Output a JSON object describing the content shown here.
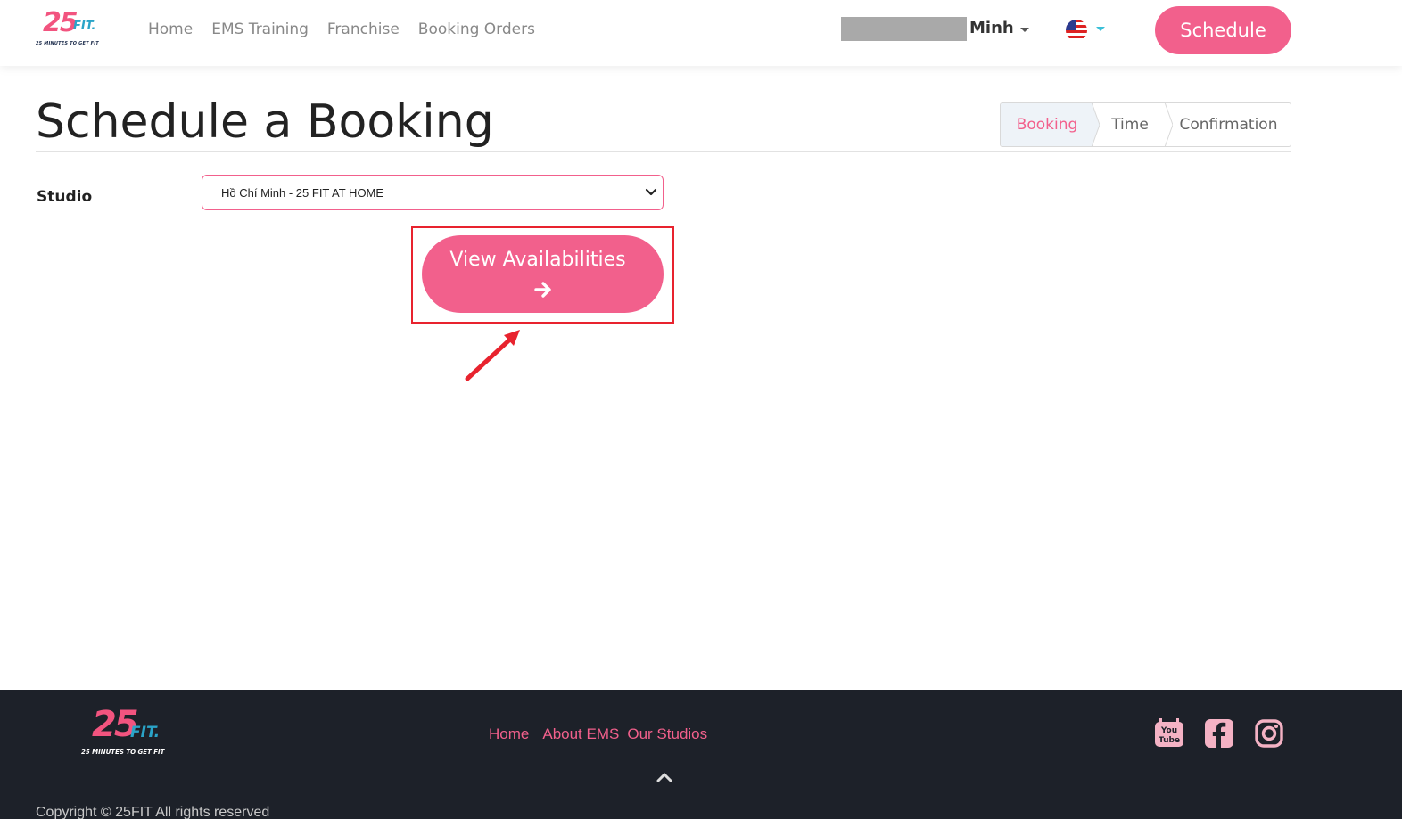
{
  "brand": {
    "logo_number": "25",
    "logo_word": "FIT.",
    "tagline": "25 MINUTES TO GET FIT"
  },
  "nav": {
    "items": [
      {
        "label": "Home"
      },
      {
        "label": "EMS Training"
      },
      {
        "label": "Franchise"
      },
      {
        "label": "Booking Orders"
      }
    ]
  },
  "user": {
    "name": "Minh"
  },
  "language": {
    "icon": "us-flag-icon"
  },
  "header": {
    "schedule_label": "Schedule"
  },
  "page": {
    "title": "Schedule a Booking"
  },
  "steps": [
    {
      "label": "Booking",
      "active": true
    },
    {
      "label": "Time",
      "active": false
    },
    {
      "label": "Confirmation",
      "active": false
    }
  ],
  "form": {
    "studio_label": "Studio",
    "studio_value": "Hồ Chí Minh - 25 FIT AT HOME"
  },
  "cta": {
    "label": "View Availabilities",
    "icon": "arrow-right-icon"
  },
  "colors": {
    "accent": "#f2608c",
    "highlight": "#e8232e",
    "footer_bg": "#1d2129"
  },
  "footer": {
    "links": [
      {
        "label": "Home"
      },
      {
        "label": "About EMS"
      },
      {
        "label": "Our Studios"
      }
    ],
    "social": [
      "youtube-icon",
      "facebook-icon",
      "instagram-icon"
    ],
    "copyright": "Copyright © 25FIT All rights reserved"
  }
}
